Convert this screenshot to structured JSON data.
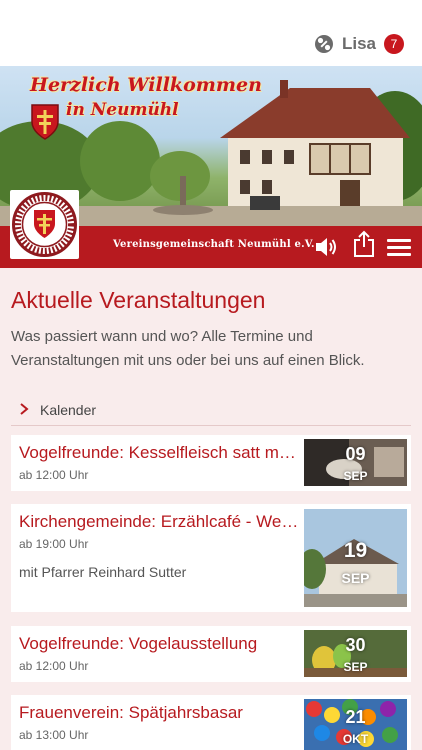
{
  "header": {
    "user_name": "Lisa",
    "notification_count": "7",
    "user_icon": "settings-dots-icon",
    "brand_color": "#b71a1f",
    "badge_color": "#c8171e"
  },
  "hero": {
    "welcome_line1": "Herzlich Willkommen",
    "welcome_line2": "in Neumühl",
    "club_name": "Vereinsgemeinschaft Neumühl e.V.",
    "logo_text": "Vereinsgemeinschaft Neumühl e.V."
  },
  "toolbar": {
    "sound_icon": "speaker-icon",
    "share_icon": "share-icon",
    "menu_icon": "hamburger-menu-icon"
  },
  "main": {
    "title": "Aktuelle Veranstaltungen",
    "description": "Was passiert wann und wo? Alle Termine und Veranstaltungen mit uns oder bei uns auf einen Blick.",
    "calendar_label": "Kalender"
  },
  "events": [
    {
      "title": "Vogelfreunde: Kesselfleisch satt mit Sauerkraut",
      "time": "ab 12:00 Uhr",
      "note": "",
      "day": "09",
      "month": "SEP"
    },
    {
      "title": "Kirchengemeinde: Erzählcafé - Weinlese",
      "time": "ab 19:00 Uhr",
      "note": "mit Pfarrer Reinhard Sutter",
      "day": "19",
      "month": "SEP"
    },
    {
      "title": "Vogelfreunde: Vogelausstellung",
      "time": "ab 12:00 Uhr",
      "note": "",
      "day": "30",
      "month": "SEP"
    },
    {
      "title": "Frauenverein: Spätjahrsbasar",
      "time": "ab 13:00 Uhr",
      "note": "",
      "day": "21",
      "month": "OKT"
    }
  ]
}
